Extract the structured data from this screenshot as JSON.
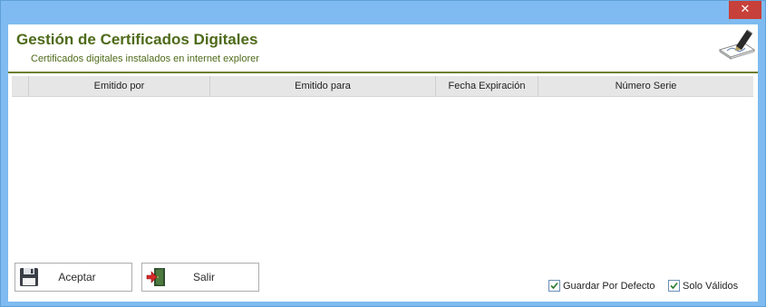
{
  "window": {
    "close_glyph": "✕"
  },
  "header": {
    "title": "Gestión de Certificados Digitales",
    "subtitle": "Certificados digitales instalados en internet explorer",
    "icon": "pen-signature-icon"
  },
  "grid": {
    "columns": [
      "",
      "Emitido por",
      "Emitido para",
      "Fecha Expiración",
      "Número Serie"
    ],
    "rows": []
  },
  "buttons": {
    "aceptar": {
      "label": "Aceptar",
      "icon": "floppy-disk-icon"
    },
    "salir": {
      "label": "Salir",
      "icon": "exit-door-icon"
    }
  },
  "options": {
    "guardar_por_defecto": {
      "label": "Guardar Por Defecto",
      "checked": true
    },
    "solo_validos": {
      "label": "Solo Válidos",
      "checked": true
    }
  },
  "colors": {
    "title": "#4e6a19",
    "header_line": "#6d7f33",
    "window_frame": "#7fbbf0",
    "close_button": "#c7403a",
    "grid_header": "#e6e6e6"
  }
}
